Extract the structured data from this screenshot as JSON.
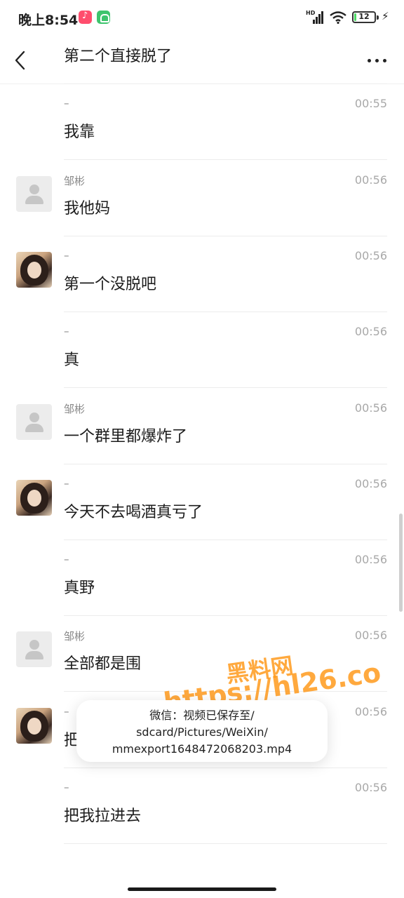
{
  "status_bar": {
    "time": "晚上8:54",
    "network_label": "HD",
    "battery_percent": 12,
    "battery_level": 0.12,
    "charging_icon": "bolt-icon",
    "app_icons": [
      "tiktok-icon",
      "android-icon"
    ]
  },
  "nav": {
    "back_icon": "chevron-left-icon",
    "more_icon": "more-icon"
  },
  "colors": {
    "watermark": "#ff9614",
    "battery": "#4cd964",
    "divider": "#ececec"
  },
  "messages": [
    {
      "sender": "",
      "time": "",
      "text": "第二个直接脱了",
      "avatar": "none"
    },
    {
      "sender": "–",
      "time": "00:55",
      "text": "我靠",
      "avatar": "none"
    },
    {
      "sender": "邹彬",
      "time": "00:56",
      "text": "我他妈",
      "avatar": "default"
    },
    {
      "sender": "–",
      "time": "00:56",
      "text": "第一个没脱吧",
      "avatar": "photo"
    },
    {
      "sender": "–",
      "time": "00:56",
      "text": "真",
      "avatar": "none"
    },
    {
      "sender": "邹彬",
      "time": "00:56",
      "text": "一个群里都爆炸了",
      "avatar": "default"
    },
    {
      "sender": "–",
      "time": "00:56",
      "text": "今天不去喝酒真亏了",
      "avatar": "photo"
    },
    {
      "sender": "–",
      "time": "00:56",
      "text": "真野",
      "avatar": "none"
    },
    {
      "sender": "邹彬",
      "time": "00:56",
      "text": "全部都是围",
      "avatar": "default"
    },
    {
      "sender": "–",
      "time": "00:56",
      "text": "把我拉进去",
      "avatar": "photo"
    },
    {
      "sender": "–",
      "time": "00:56",
      "text": "把我拉进去",
      "avatar": "none"
    }
  ],
  "toast": {
    "line1": "微信：视频已保存至/",
    "line2": "sdcard/Pictures/WeiXin/",
    "line3": "mmexport1648472068203.mp4"
  },
  "watermark": {
    "title": "黑料网",
    "url": "https://hl26.co"
  }
}
